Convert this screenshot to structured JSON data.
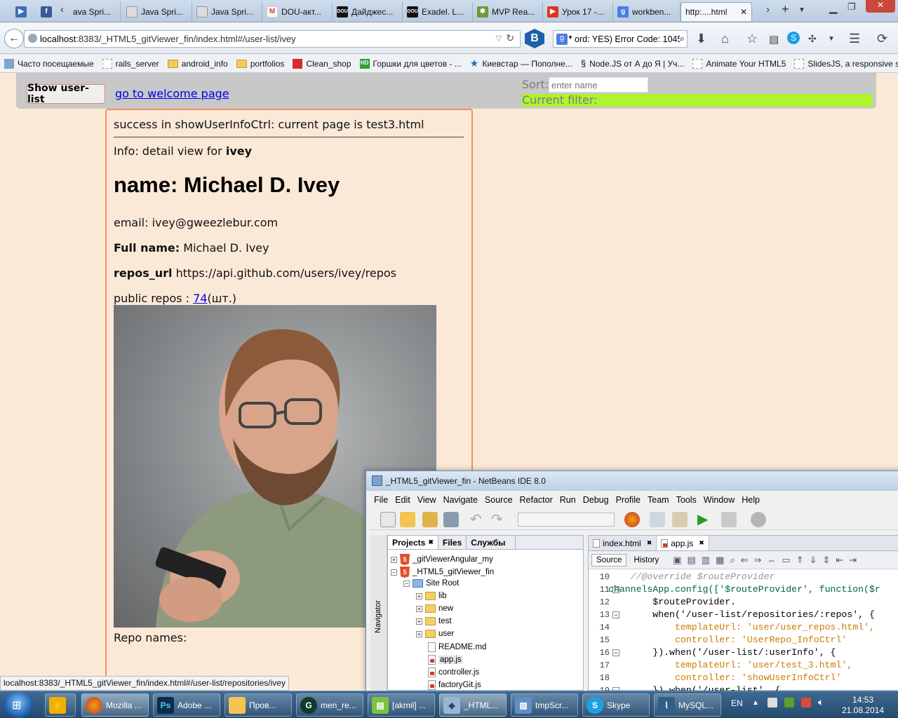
{
  "browser": {
    "tabs": [
      {
        "label": "",
        "icon": "play-icon"
      },
      {
        "label": "",
        "icon": "facebook-icon"
      },
      {
        "label": "ava Spri...",
        "icon": "page-icon"
      },
      {
        "label": "Java Spri...",
        "icon": "page-icon"
      },
      {
        "label": "Java Spri...",
        "icon": "page-icon"
      },
      {
        "label": "DOU-акт...",
        "icon": "gmail-icon"
      },
      {
        "label": "Дайджес...",
        "icon": "dou-icon"
      },
      {
        "label": "Exadel. L...",
        "icon": "dou-icon"
      },
      {
        "label": "MVP Rea...",
        "icon": "gear-icon"
      },
      {
        "label": "Урок 17 -...",
        "icon": "youtube-icon"
      },
      {
        "label": "workben...",
        "icon": "google-icon"
      },
      {
        "label": "http:....html",
        "icon": ""
      }
    ],
    "url_host": "localhost",
    "url_rest": ":8383/_HTML5_gitViewer_fin/index.html#/user-list/ivey",
    "search_value": "ord: YES) Error Code: 1045",
    "bookmarks": [
      {
        "label": "Часто посещаемые",
        "icon": "page-icon"
      },
      {
        "label": "rails_server",
        "icon": "page-icon"
      },
      {
        "label": "android_info",
        "icon": "folder-icon"
      },
      {
        "label": "portfolios",
        "icon": "folder-icon"
      },
      {
        "label": "Clean_shop",
        "icon": "cart-icon"
      },
      {
        "label": "Горшки для цветов - ...",
        "icon": "hd-icon"
      },
      {
        "label": "Киевстар — Пополне...",
        "icon": "star-icon"
      },
      {
        "label": "Node.JS от А до Я | Уч...",
        "icon": "node-icon"
      },
      {
        "label": "Animate Your HTML5",
        "icon": "page-icon"
      },
      {
        "label": "SlidesJS, a responsive s...",
        "icon": "page-icon"
      }
    ],
    "status_url": "localhost:8383/_HTML5_gitViewer_fin/index.html#/user-list/repositories/ivey"
  },
  "page": {
    "show_button": "Show user-list",
    "welcome_link": "go to welcome page",
    "sort_label": "Sort:",
    "sort_placeholder": "enter name",
    "filter_label": "Current filter:",
    "success_text": "success in showUserInfoCtrl: current page is test3.html",
    "info_prefix": "Info: detail view for ",
    "info_user": "ivey",
    "name_heading": "name: Michael D. Ivey",
    "email": "email: ivey@gweezlebur.com",
    "fullname_label": "Full name:",
    "fullname_value": " Michael D. Ivey",
    "repos_url_label": "repos_url",
    "repos_url_value": " https://api.github.com/users/ivey/repos",
    "public_repos_label": "public repos : ",
    "public_repos_count": "74",
    "public_repos_unit": "(шт.)",
    "repo_names_label": "Repo names:"
  },
  "netbeans": {
    "title": "_HTML5_gitViewer_fin - NetBeans IDE 8.0",
    "menu": [
      "File",
      "Edit",
      "View",
      "Navigate",
      "Source",
      "Refactor",
      "Run",
      "Debug",
      "Profile",
      "Team",
      "Tools",
      "Window",
      "Help"
    ],
    "navigator_label": "Navigator",
    "panel_tabs": [
      "Projects",
      "Files",
      "Службы"
    ],
    "tree": [
      {
        "label": "_gitViewerAngular_my",
        "type": "html5"
      },
      {
        "label": "_HTML5_gitViewer_fin",
        "type": "html5"
      },
      {
        "label": "Site Root",
        "type": "folder"
      },
      {
        "label": "lib",
        "type": "folder"
      },
      {
        "label": "new",
        "type": "folder"
      },
      {
        "label": "test",
        "type": "folder"
      },
      {
        "label": "user",
        "type": "folder"
      },
      {
        "label": "README.md",
        "type": "file"
      },
      {
        "label": "app.js",
        "type": "js"
      },
      {
        "label": "controller.js",
        "type": "js"
      },
      {
        "label": "factoryGit.js",
        "type": "js"
      }
    ],
    "editor_tabs": [
      "index.html",
      "app.js"
    ],
    "source_btn": "Source",
    "history_btn": "History",
    "line_numbers": [
      "10",
      "11",
      "12",
      "13",
      "14",
      "15",
      "16",
      "17",
      "18",
      "19"
    ],
    "code": [
      "    //@override $routeProvider",
      "channelsApp.config(['$routeProvider', function($r",
      "        $routeProvider.",
      "        when('/user-list/repositories/:repos', {",
      "            templateUrl: 'user/user_repos.html',",
      "            controller: 'UserRepo_InfoCtrl'",
      "        }).when('/user-list/:userInfo', {",
      "            templateUrl: 'user/test_3.html',",
      "            controller: 'showUserInfoCtrl'",
      "        }).when('/user-list', {"
    ]
  },
  "taskbar": {
    "items": [
      {
        "label": "",
        "icon": "winamp-icon"
      },
      {
        "label": "Mozilla ...",
        "icon": "firefox-icon"
      },
      {
        "label": "Adobe ...",
        "icon": "photoshop-icon"
      },
      {
        "label": "Пров...",
        "icon": "explorer-icon"
      },
      {
        "label": "men_re...",
        "icon": "app-icon"
      },
      {
        "label": "[akmil] ...",
        "icon": "editor-icon"
      },
      {
        "label": "_HTML...",
        "icon": "netbeans-icon"
      },
      {
        "label": "tmpScr...",
        "icon": "image-icon"
      },
      {
        "label": "Skype",
        "icon": "skype-icon"
      },
      {
        "label": "MySQL...",
        "icon": "mysql-icon"
      }
    ],
    "lang": "EN",
    "time": "14:53",
    "date": "21.08.2014"
  },
  "colors": {
    "page_bg": "#fbe9d7",
    "filter_bg": "#aef42f",
    "card_border": "#f39060",
    "link": "#0000ee"
  }
}
